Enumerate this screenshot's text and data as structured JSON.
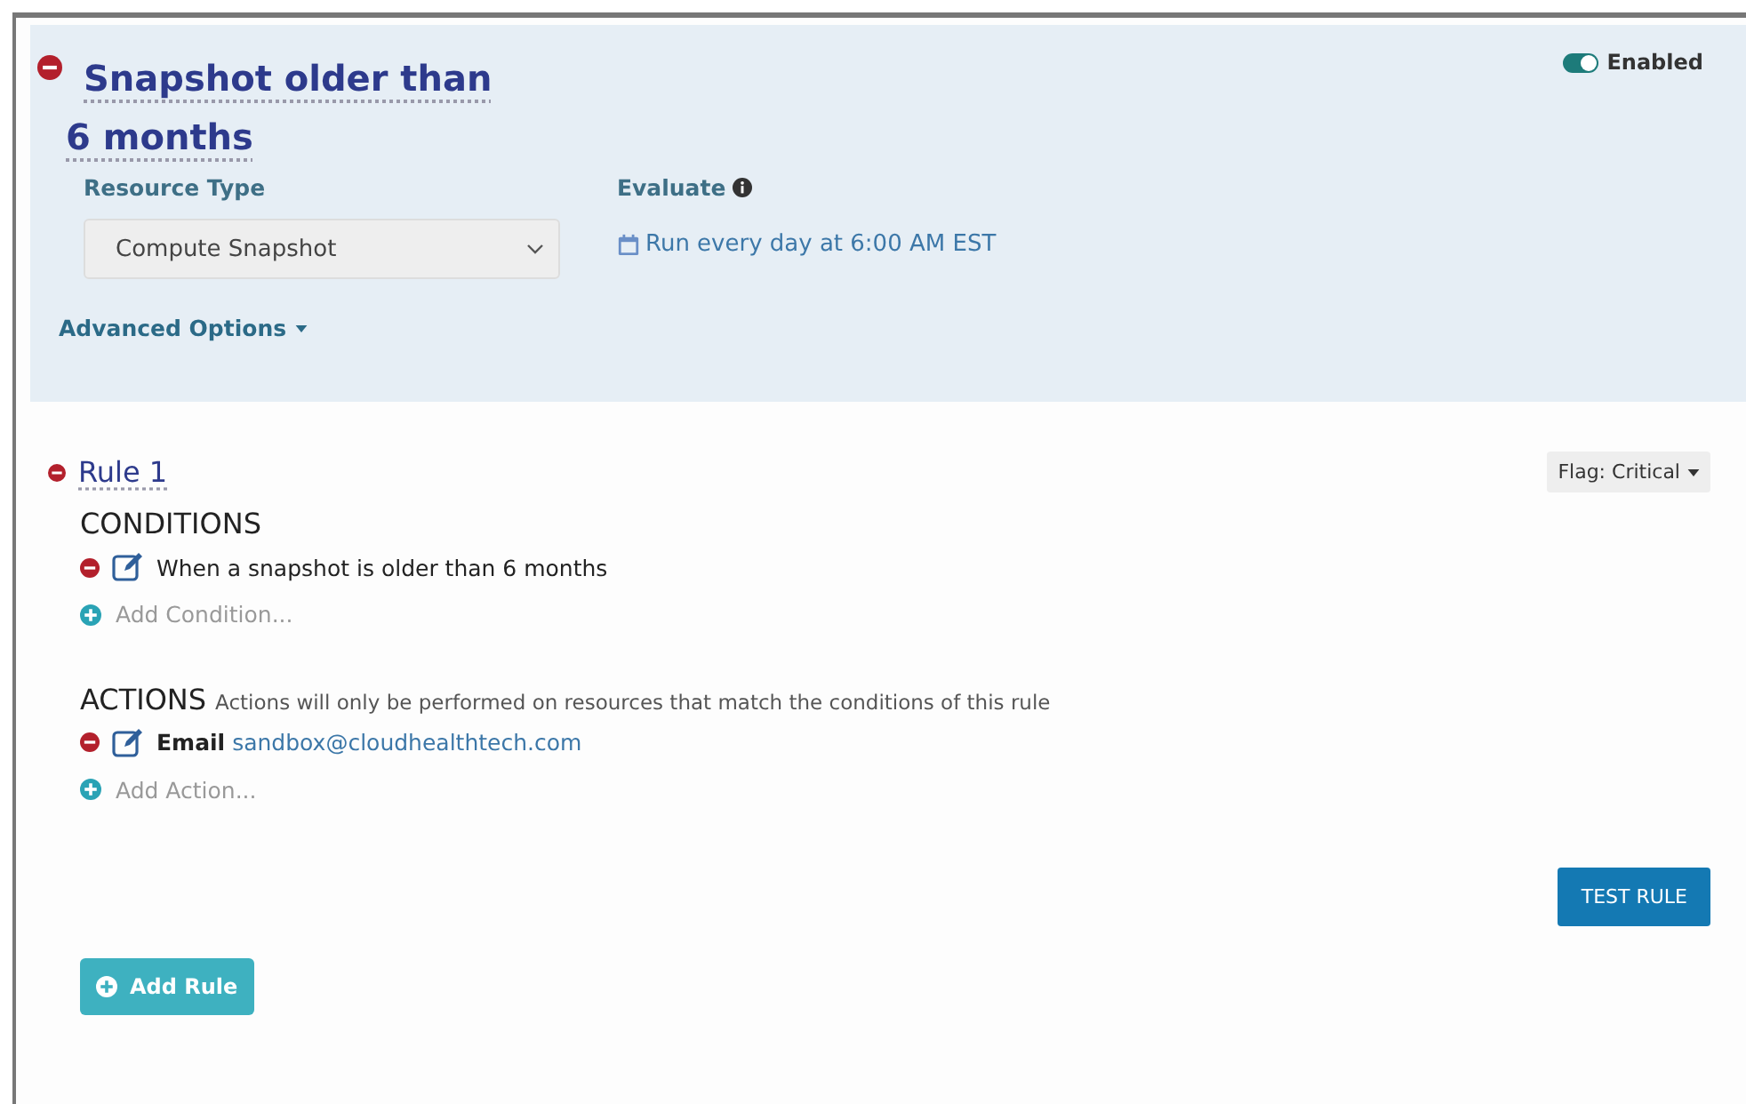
{
  "policy": {
    "title": "Snapshot older than 6 months",
    "enabled": true,
    "enabled_label": "Enabled",
    "resource_type": {
      "label": "Resource Type",
      "value": "Compute Snapshot"
    },
    "evaluate": {
      "label": "Evaluate",
      "schedule": "Run every day at 6:00 AM EST"
    },
    "advanced_options": "Advanced Options"
  },
  "rule": {
    "title": "Rule 1",
    "flag": "Flag: Critical",
    "conditions": {
      "heading": "CONDITIONS",
      "items": [
        {
          "text": "When a snapshot is older than 6 months"
        }
      ],
      "add": "Add Condition..."
    },
    "actions": {
      "heading": "ACTIONS",
      "note": "Actions will only be performed on resources that match the conditions of this rule",
      "items": [
        {
          "label": "Email",
          "value": "sandbox@cloudhealthtech.com"
        }
      ],
      "add": "Add Action..."
    },
    "test_button": "TEST RULE"
  },
  "add_rule_button": "Add Rule"
}
